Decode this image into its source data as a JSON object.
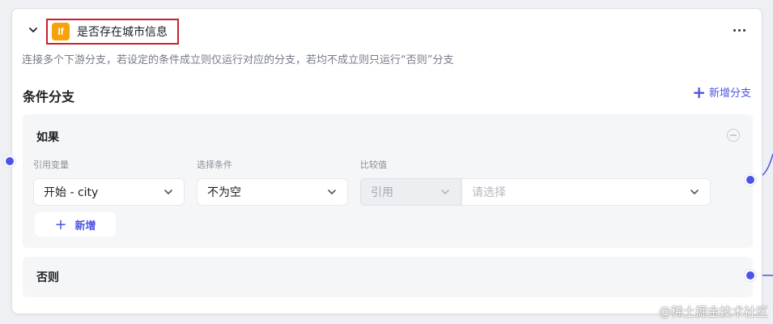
{
  "node": {
    "type_badge": "If",
    "title": "是否存在城市信息",
    "description": "连接多个下游分支，若设定的条件成立则仅运行对应的分支，若均不成立则只运行“否则”分支"
  },
  "branches": {
    "section_title": "条件分支",
    "add_branch_label": "新增分支",
    "if_branch": {
      "label": "如果",
      "field_labels": {
        "variable": "引用变量",
        "condition": "选择条件",
        "compare": "比较值"
      },
      "condition": {
        "variable_value": "开始 - city",
        "operator_value": "不为空",
        "compare_type_value": "引用",
        "compare_placeholder": "请选择"
      },
      "add_condition_label": "新增"
    },
    "else_branch": {
      "label": "否则"
    }
  },
  "watermark": "@稀土掘金技术社区",
  "colors": {
    "accent": "#4d53e8",
    "badge": "#f5a30b",
    "highlight_border": "#cc1f2c"
  },
  "icons": [
    "chevron-down-icon",
    "more-icon",
    "plus-icon",
    "remove-circle-icon"
  ]
}
